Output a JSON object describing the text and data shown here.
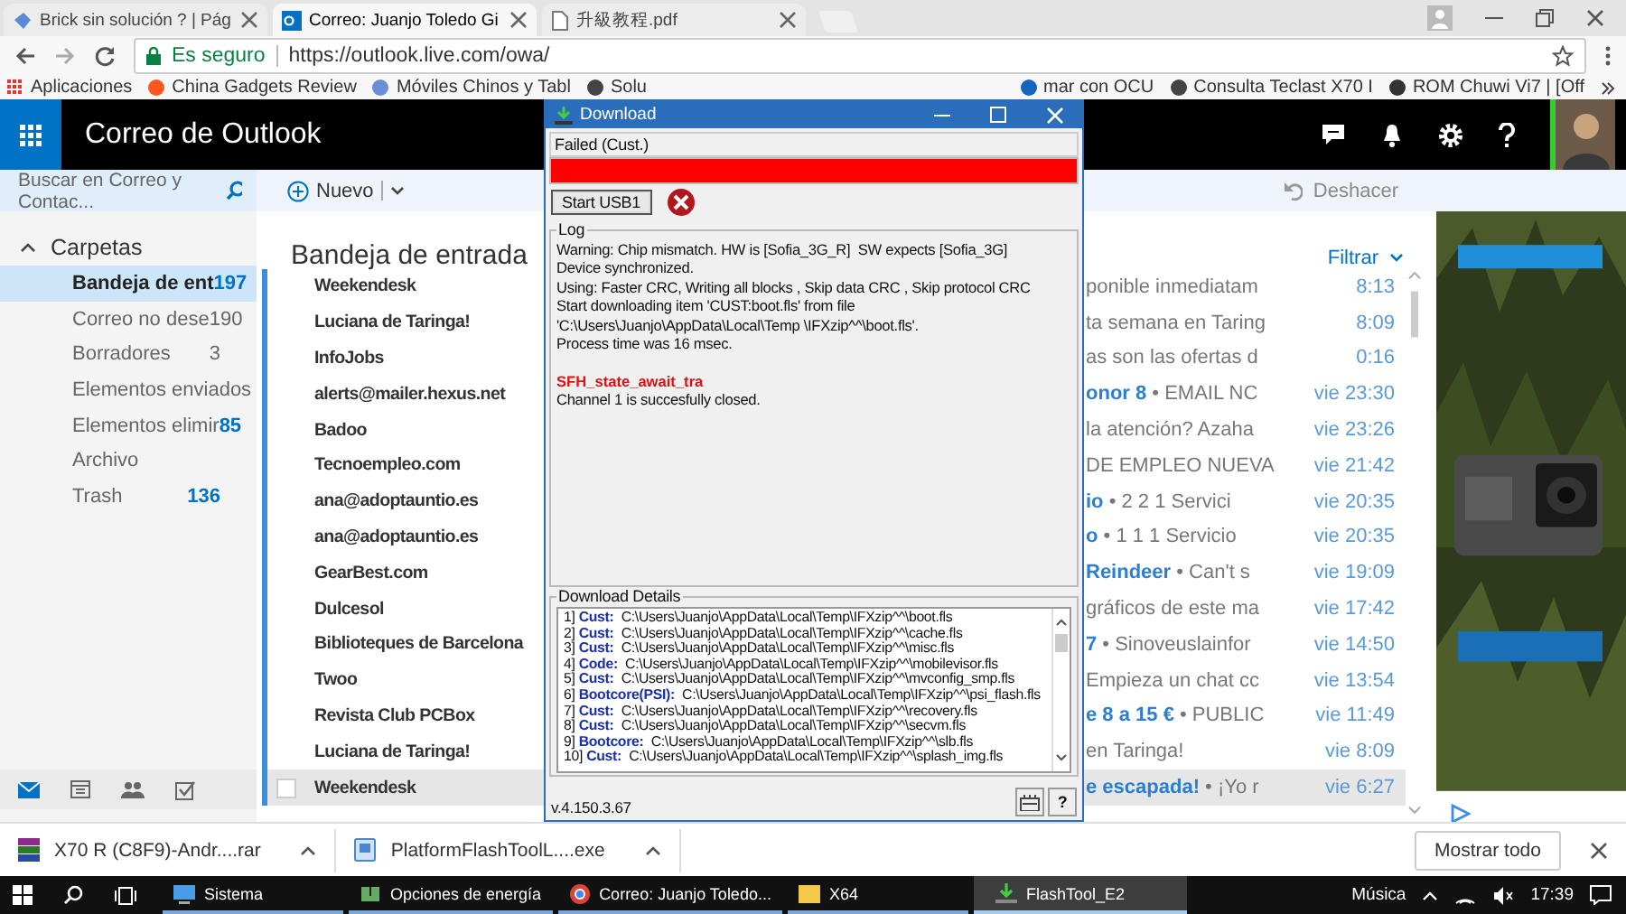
{
  "browser": {
    "tabs": [
      {
        "label": "Brick sin solución ? | Pág",
        "selected": false
      },
      {
        "label": "Correo: Juanjo Toledo Gi",
        "selected": true
      },
      {
        "label": "升級教程.pdf",
        "selected": false
      }
    ],
    "security": "Es seguro",
    "url": "https://outlook.live.com/owa/",
    "bookmarks": [
      "Aplicaciones",
      "China Gadgets Review",
      "Móviles Chinos y Tabl",
      "Solu"
    ],
    "bookmarks_right": [
      "mar con OCU",
      "Consulta Teclast X70 I",
      "ROM Chuwi Vi7 | [Off"
    ]
  },
  "outlook": {
    "app_title": "Correo de Outlook",
    "search": {
      "placeholder": "Buscar en Correo y Contac..."
    },
    "new_button": "Nuevo",
    "undo_button": "Deshacer",
    "folders_header": "Carpetas",
    "folders": [
      {
        "name": "Bandeja de ent",
        "count": "197",
        "kind": "unread",
        "selected": true
      },
      {
        "name": "Correo no dese",
        "count": "190",
        "kind": "total",
        "selected": false
      },
      {
        "name": "Borradores",
        "count": "3",
        "kind": "total",
        "selected": false
      },
      {
        "name": "Elementos enviados",
        "selected": false
      },
      {
        "name": "Elementos elimir",
        "count": "85",
        "kind": "unread",
        "selected": false
      },
      {
        "name": "Archivo",
        "selected": false
      },
      {
        "name": "Trash",
        "count": "136",
        "kind": "unread",
        "selected": false
      }
    ],
    "list_title": "Bandeja de entrada",
    "filter": "Filtrar",
    "messages": [
      {
        "sender": "Weekendesk",
        "preview": "ponible inmediatam",
        "time": "8:13",
        "selected": false
      },
      {
        "sender": "Luciana de Taringa!",
        "preview": "ta semana en Taring",
        "time": "8:09",
        "selected": false
      },
      {
        "sender": "InfoJobs",
        "preview": "as son las ofertas d",
        "time": "0:16",
        "selected": false
      },
      {
        "sender": "alerts@mailer.hexus.net",
        "subject": "onor 8",
        "separator": "•",
        "preview": "EMAIL NC",
        "time": "vie 23:30",
        "selected": false
      },
      {
        "sender": "Badoo",
        "preview": "la atención? Azaha",
        "time": "vie 23:26",
        "selected": false
      },
      {
        "sender": "Tecnoempleo.com",
        "preview": "DE EMPLEO NUEVA",
        "time": "vie 21:42",
        "selected": false
      },
      {
        "sender": "ana@adoptauntio.es",
        "subject": "io",
        "separator": "•",
        "preview": "2 2 1     Servici",
        "time": "vie 20:35",
        "selected": false
      },
      {
        "sender": "ana@adoptauntio.es",
        "subject": "o",
        "separator": "•",
        "preview": "1 1 1     Servicio",
        "time": "vie 20:35",
        "selected": false
      },
      {
        "sender": "GearBest.com",
        "subject": "Reindeer",
        "separator": "•",
        "preview": "Can't s",
        "time": "vie 19:09",
        "selected": false
      },
      {
        "sender": "Dulcesol",
        "preview": "gráficos de este ma",
        "time": "vie 17:42",
        "selected": false
      },
      {
        "sender": "Biblioteques de Barcelona",
        "subject": "7",
        "separator": "•",
        "preview": "Sinoveuslainfor",
        "time": "vie 14:50",
        "selected": false
      },
      {
        "sender": "Twoo",
        "preview": "Empieza un chat cc",
        "time": "vie 13:54",
        "selected": false
      },
      {
        "sender": "Revista Club PCBox",
        "subject": "e 8 a 15 €",
        "separator": "•",
        "preview": "PUBLIC",
        "time": "vie 11:49",
        "selected": false
      },
      {
        "sender": "Luciana de Taringa!",
        "preview": "en Taringa!",
        "time": "vie 8:09",
        "selected": false
      },
      {
        "sender": "Weekendesk",
        "subject": "e escapada!",
        "separator": "•",
        "preview": "¡Yo r",
        "time": "vie 6:27",
        "selected": true
      }
    ]
  },
  "dialog": {
    "title": "Download",
    "status": "Failed (Cust.)",
    "progress": {
      "level": 1
    },
    "start_button": "Start USB1",
    "log_label": "Log",
    "log": [
      {
        "text": "Warning: Chip mismatch. HW is [Sofia_3G_R]  SW expects [Sofia_3G]",
        "kind": "info"
      },
      {
        "text": "Device synchronized.",
        "kind": "info"
      },
      {
        "text": "Using: Faster CRC, Writing all blocks , Skip data CRC , Skip protocol CRC",
        "kind": "info"
      },
      {
        "text": "Start downloading item 'CUST:boot.fls' from file 'C:\\Users\\Juanjo\\AppData\\Local\\Temp \\IFXzip^^\\boot.fls'.",
        "kind": "info"
      },
      {
        "text": "Process time was 16 msec.",
        "kind": "info"
      },
      {
        "text": "SFH_state_await_tra",
        "kind": "error"
      },
      {
        "text": "Channel 1 is succesfully closed.",
        "kind": "info"
      }
    ],
    "details_label": "Download Details",
    "details": [
      {
        "index": "1]",
        "type": "Cust:",
        "path": "C:\\Users\\Juanjo\\AppData\\Local\\Temp\\IFXzip^^\\boot.fls"
      },
      {
        "index": "2]",
        "type": "Cust:",
        "path": "C:\\Users\\Juanjo\\AppData\\Local\\Temp\\IFXzip^^\\cache.fls"
      },
      {
        "index": "3]",
        "type": "Cust:",
        "path": "C:\\Users\\Juanjo\\AppData\\Local\\Temp\\IFXzip^^\\misc.fls"
      },
      {
        "index": "4]",
        "type": "Code:",
        "path": "C:\\Users\\Juanjo\\AppData\\Local\\Temp\\IFXzip^^\\mobilevisor.fls"
      },
      {
        "index": "5]",
        "type": "Cust:",
        "path": "C:\\Users\\Juanjo\\AppData\\Local\\Temp\\IFXzip^^\\mvconfig_smp.fls"
      },
      {
        "index": "6]",
        "type": "Bootcore(PSI):",
        "path": "C:\\Users\\Juanjo\\AppData\\Local\\Temp\\IFXzip^^\\psi_flash.fls"
      },
      {
        "index": "7]",
        "type": "Cust:",
        "path": "C:\\Users\\Juanjo\\AppData\\Local\\Temp\\IFXzip^^\\recovery.fls"
      },
      {
        "index": "8]",
        "type": "Cust:",
        "path": "C:\\Users\\Juanjo\\AppData\\Local\\Temp\\IFXzip^^\\secvm.fls"
      },
      {
        "index": "9]",
        "type": "Bootcore:",
        "path": "C:\\Users\\Juanjo\\AppData\\Local\\Temp\\IFXzip^^\\slb.fls"
      },
      {
        "index": "10]",
        "type": "Cust:",
        "path": "C:\\Users\\Juanjo\\AppData\\Local\\Temp\\IFXzip^^\\splash_img.fls"
      }
    ],
    "version": "v.4.150.3.67",
    "help_button": "?"
  },
  "downloads": {
    "files": [
      {
        "name": "X70 R (C8F9)-Andr....rar",
        "kind": "archive"
      },
      {
        "name": "PlatformFlashToolL....exe",
        "kind": "installer"
      }
    ],
    "show_all": "Mostrar todo"
  },
  "taskbar": {
    "items": [
      {
        "label": "Sistema",
        "kind": "system",
        "selected": false
      },
      {
        "label": "Opciones de energía",
        "kind": "power",
        "selected": false
      },
      {
        "label": "Correo: Juanjo Toledo...",
        "kind": "browser",
        "selected": false
      },
      {
        "label": "X64",
        "kind": "folder",
        "selected": false
      },
      {
        "label": "FlashTool_E2",
        "kind": "flash",
        "selected": true
      }
    ],
    "tray_label": "Música",
    "time": "17:39"
  }
}
